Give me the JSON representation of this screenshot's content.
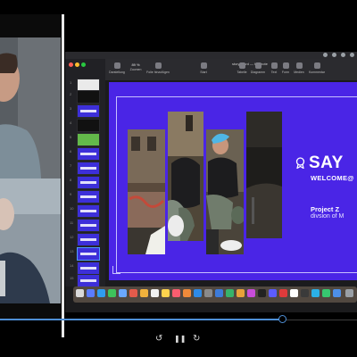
{
  "app": {
    "window_title": "storyboard — Keynote",
    "slide_numbers": [
      "1",
      "2",
      "3",
      "4",
      "5",
      "6",
      "7",
      "8",
      "9",
      "10",
      "11",
      "12",
      "13",
      "14",
      "15"
    ]
  },
  "toolbar": {
    "zoom": "89 %",
    "items": [
      "Darstellung",
      "Zoomen",
      "Folie hinzufügen",
      "Start",
      "Tabelle",
      "Diagramm",
      "Text",
      "Form",
      "Medien",
      "Kommentar"
    ]
  },
  "slide": {
    "title": "SAY",
    "welcome": "WELCOME@",
    "project": "Project Z",
    "division": "divsion of M",
    "background_color": "#4a25e6"
  },
  "player": {
    "progress": 0.79,
    "controls": [
      "rewind-icon",
      "pause-icon",
      "forward-icon"
    ],
    "rewind_label": "↺",
    "pause_label": "❚❚",
    "forward_label": "↻"
  }
}
